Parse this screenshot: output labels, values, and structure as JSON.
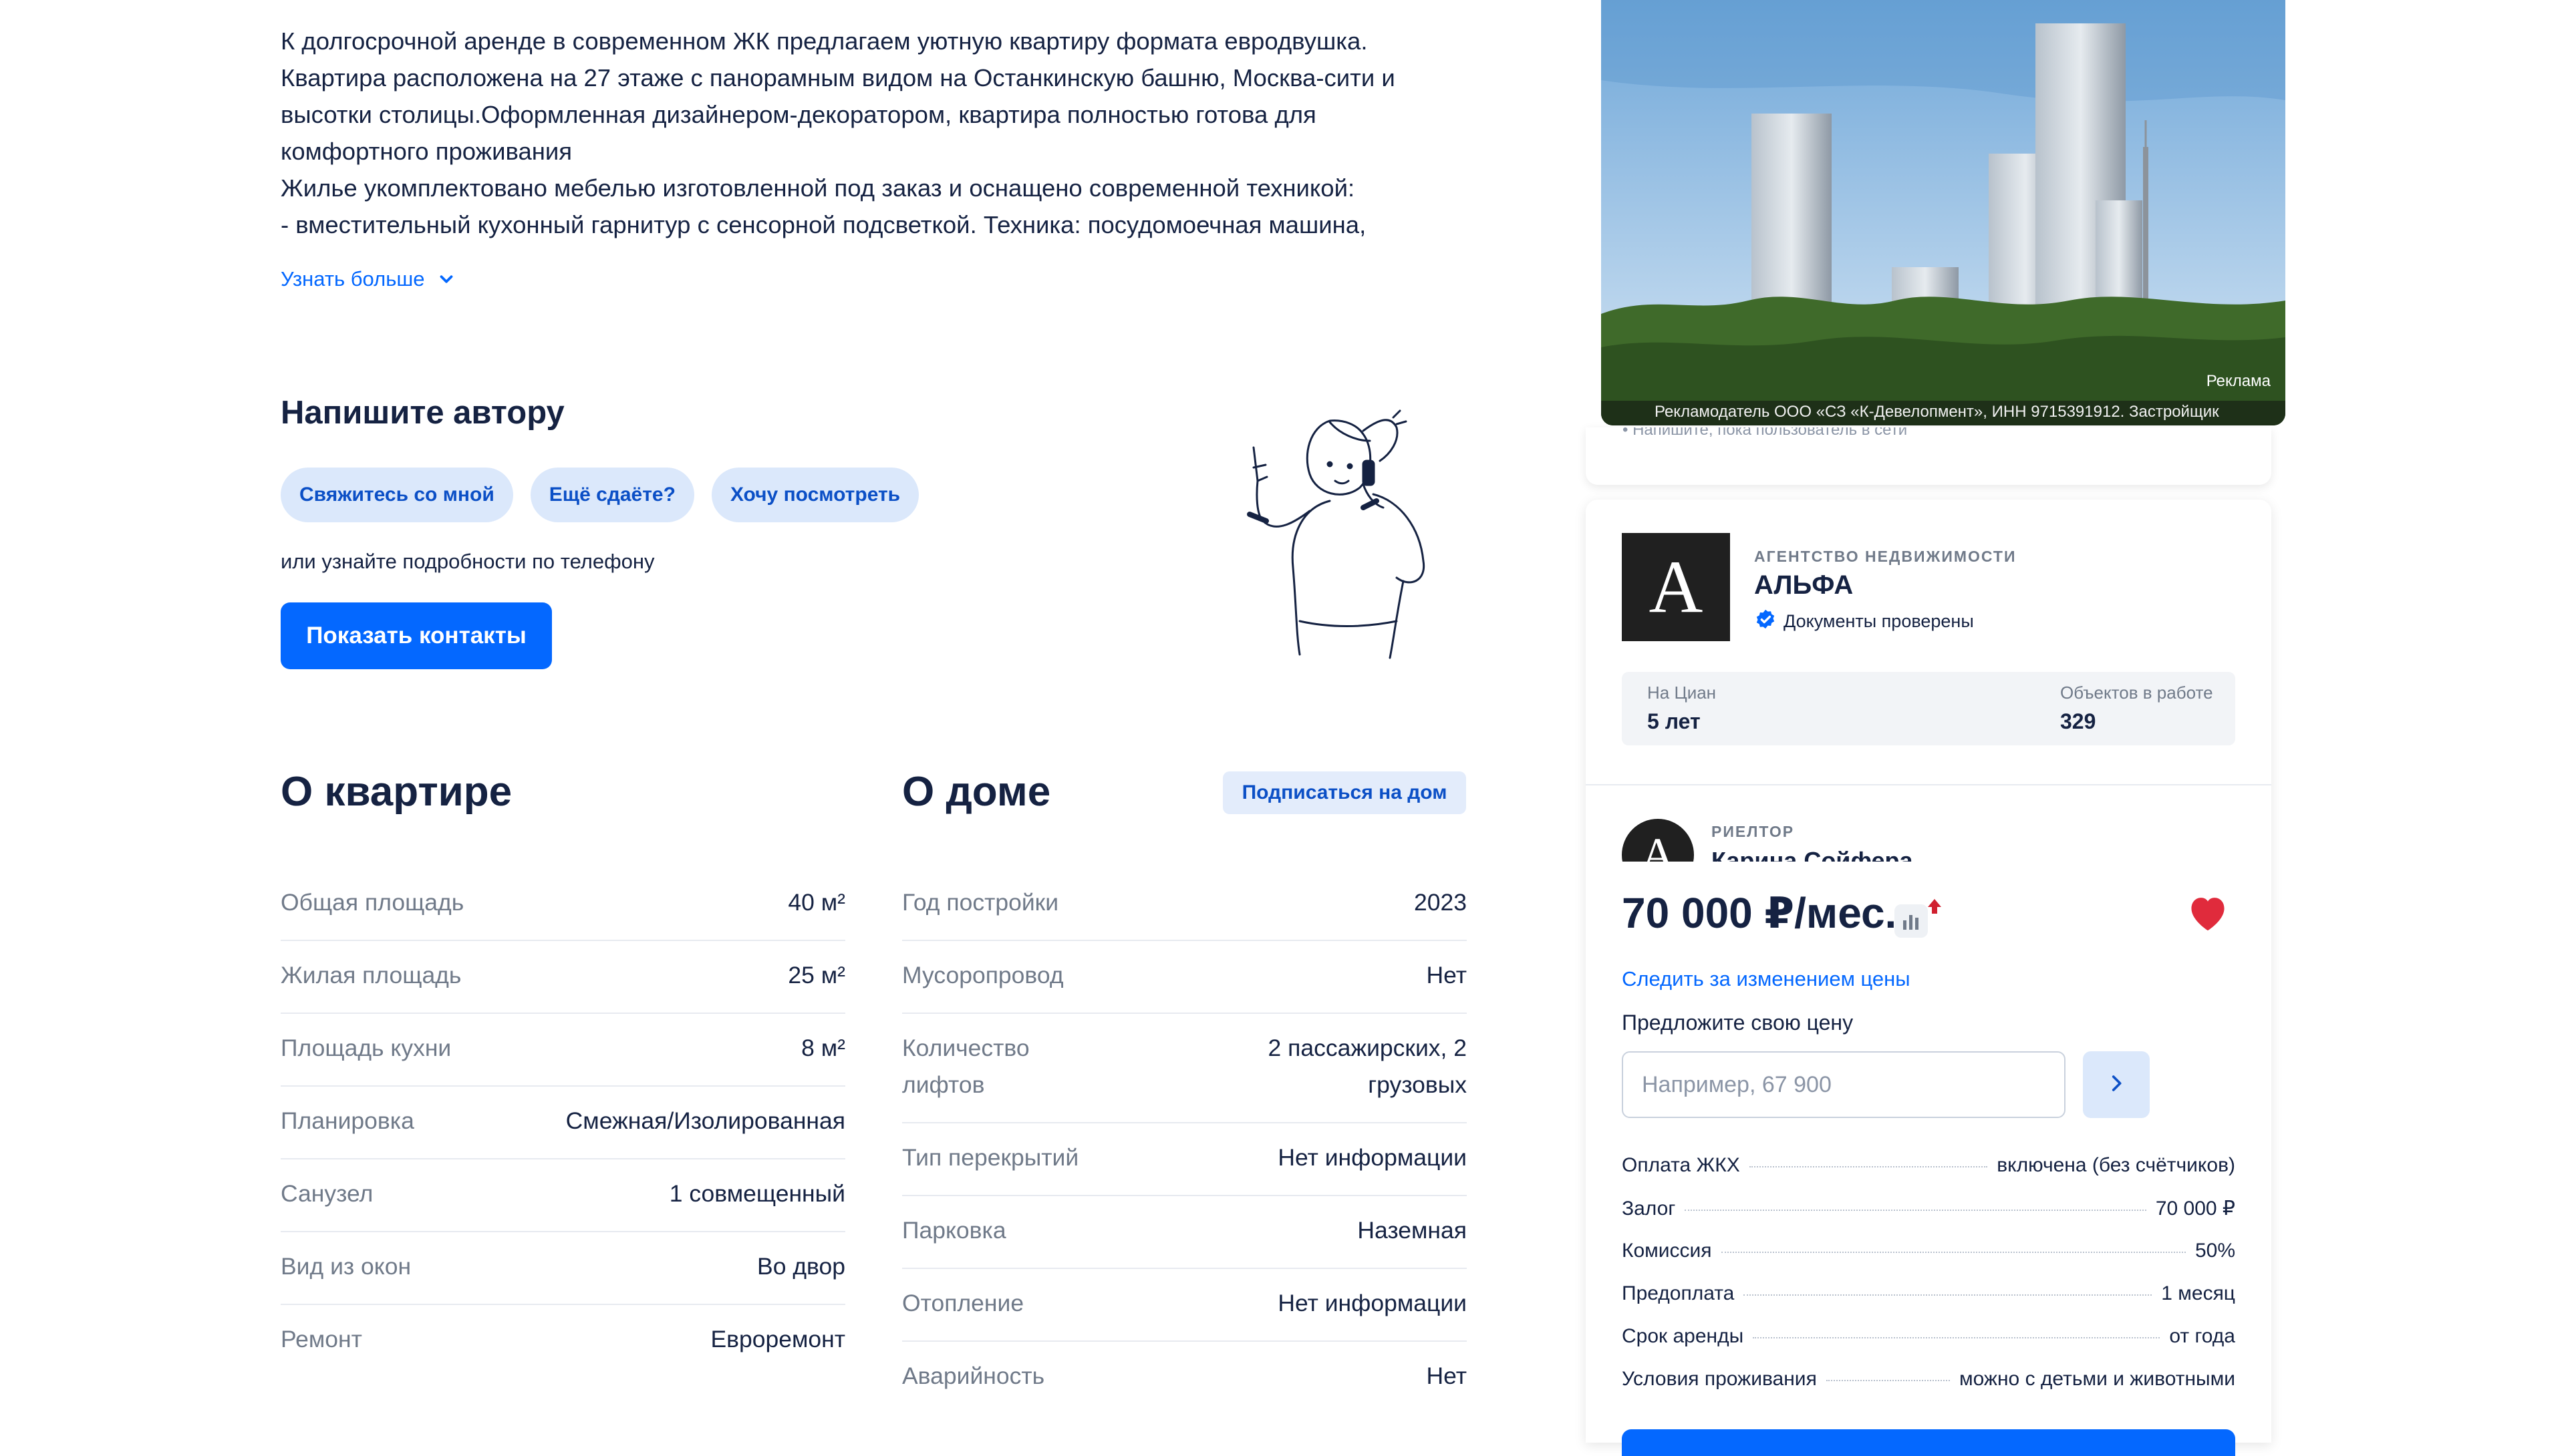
{
  "description": {
    "lines": [
      "К долгосрочной аренде в современном ЖК предлагаем уютную квартиру формата евродвушка.",
      "Квартира расположена на 27 этаже с панорамным видом на Останкинскую башню, Москва-сити и",
      "высотки столицы.Оформленная дизайнером-декоратором, квартира полностью готова для",
      "комфортного проживания",
      "Жилье укомплектовано мебелью изготовленной под заказ и оснащено современной техникой:",
      "- вместительный кухонный гарнитур с сенсорной подсветкой. Техника: посудомоечная машина,"
    ],
    "more_label": "Узнать больше"
  },
  "write_author": {
    "title": "Напишите автору",
    "chips": [
      "Свяжитесь со мной",
      "Ещё сдаёте?",
      "Хочу посмотреть"
    ],
    "phone_note": "или узнайте подробности по телефону",
    "show_contacts_label": "Показать контакты"
  },
  "apartment": {
    "title": "О квартире",
    "rows": [
      {
        "key": "Общая площадь",
        "value": "40 м²"
      },
      {
        "key": "Жилая площадь",
        "value": "25 м²"
      },
      {
        "key": "Площадь кухни",
        "value": "8 м²"
      },
      {
        "key": "Планировка",
        "value": "Смежная/Изолированная"
      },
      {
        "key": "Санузел",
        "value": "1 совмещенный"
      },
      {
        "key": "Вид из окон",
        "value": "Во двор"
      },
      {
        "key": "Ремонт",
        "value": "Евроремонт"
      }
    ]
  },
  "house": {
    "title": "О доме",
    "subscribe_label": "Подписаться на дом",
    "rows": [
      {
        "key": "Год постройки",
        "value": "2023"
      },
      {
        "key": "Мусоропровод",
        "value": "Нет"
      },
      {
        "key": "Количество лифтов",
        "value": "2 пассажирских, 2 грузовых"
      },
      {
        "key": "Тип перекрытий",
        "value": "Нет информации"
      },
      {
        "key": "Парковка",
        "value": "Наземная"
      },
      {
        "key": "Отопление",
        "value": "Нет информации"
      },
      {
        "key": "Аварийность",
        "value": "Нет"
      }
    ]
  },
  "ad": {
    "tag": "Реклама",
    "legal": "Рекламодатель ООО «СЗ «К-Девелопмент», ИНН 9715391912. Застройщик"
  },
  "card_strip_text": "• Напишите, пока пользователь в сети",
  "agency": {
    "logo_letter": "A",
    "type": "АГЕНТСТВО НЕДВИЖИМОСТИ",
    "name": "АЛЬФА",
    "verified": "Документы проверены",
    "stats": {
      "on_cian_label": "На Циан",
      "on_cian_value": "5 лет",
      "objects_label": "Объектов в работе",
      "objects_value": "329"
    }
  },
  "realtor": {
    "avatar_letter": "A",
    "type": "РИЕЛТОР",
    "name": "Карина Сойфера"
  },
  "price": {
    "value": "70 000 ₽/мес.",
    "follow_label": "Следить за изменением цены",
    "offer_label": "Предложите свою цену",
    "offer_placeholder": "Например, 67 900"
  },
  "terms": [
    {
      "key": "Оплата ЖКХ",
      "value": "включена (без счётчиков)"
    },
    {
      "key": "Залог",
      "value": "70 000 ₽"
    },
    {
      "key": "Комиссия",
      "value": "50%"
    },
    {
      "key": "Предоплата",
      "value": "1 месяц"
    },
    {
      "key": "Срок аренды",
      "value": "от года"
    },
    {
      "key": "Условия проживания",
      "value": "можно с детьми и животными"
    }
  ],
  "colors": {
    "accent": "#0468ff",
    "chip_bg": "#dbe8fb",
    "text": "#152242",
    "muted": "#707a89",
    "heart": "#e02b3c"
  }
}
